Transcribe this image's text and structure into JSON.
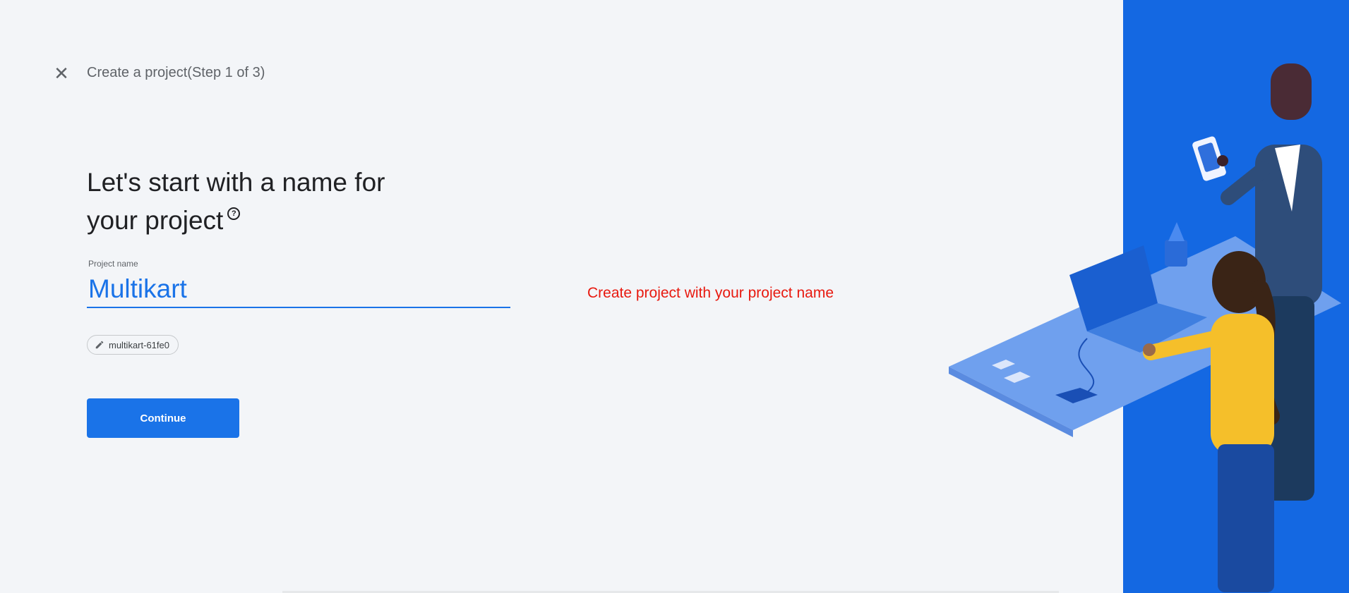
{
  "header": {
    "close_icon": "close-icon",
    "step_title": "Create a project(Step 1 of 3)"
  },
  "main": {
    "heading_line1": "Let's start with a name for",
    "heading_line2": "your project",
    "help_icon": "help-circle-icon",
    "field_label": "Project name",
    "project_name_value": "Multikart",
    "project_id_icon": "pencil-icon",
    "project_id": "multikart-61fe0",
    "continue_label": "Continue"
  },
  "annotation": "Create project with your project name",
  "colors": {
    "accent": "#1a73e8",
    "annotation": "#e8190f",
    "panel": "#1468e2",
    "background": "#f3f5f8"
  }
}
